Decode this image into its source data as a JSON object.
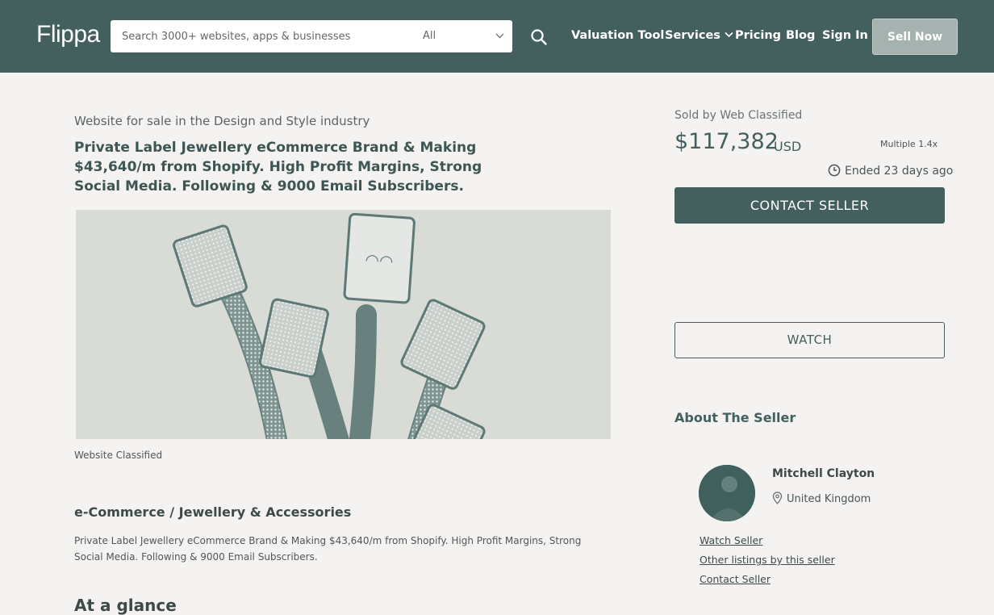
{
  "header": {
    "logo": "Flippa",
    "search_placeholder": "Search 3000+ websites, apps & businesses",
    "search_filter": "All",
    "nav": [
      "Valuation Tool",
      "Services",
      "Pricing",
      "Blog",
      "Sign In"
    ],
    "sell_button": "Sell Now"
  },
  "listing": {
    "category_line": "Website for sale in the Design and Style industry",
    "title": "Private Label Jewellery eCommerce Brand & Making $43,640/m from Shopify. High Profit Margins, Strong Social Media. Following & 9000 Email Subscribers.",
    "image_caption": "Website Classified",
    "niche": "e-Commerce / Jewellery & Accessories",
    "summary": "Private Label Jewellery eCommerce Brand & Making $43,640/m from Shopify. High Profit Margins, Strong Social Media. Following & 9000 Email Subscribers.",
    "next_section": "At a glance"
  },
  "sidebar": {
    "sold_by": "Sold by Web Classified",
    "price": "$117,382",
    "currency": "USD",
    "multiple": "Multiple 1.4x",
    "ended": "Ended 23 days ago",
    "contact_button": "CONTACT SELLER",
    "watch_button": "WATCH",
    "about_title": "About The Seller",
    "seller": {
      "name": "Mitchell Clayton",
      "location": "United Kingdom",
      "links": [
        "Watch Seller",
        "Other listings by this seller",
        "Contact Seller"
      ]
    }
  },
  "colors": {
    "brand": "#43605e",
    "background": "#f4f3f1"
  },
  "icons": [
    "search-icon",
    "chevron-down-icon",
    "clock-icon",
    "location-pin-icon"
  ]
}
